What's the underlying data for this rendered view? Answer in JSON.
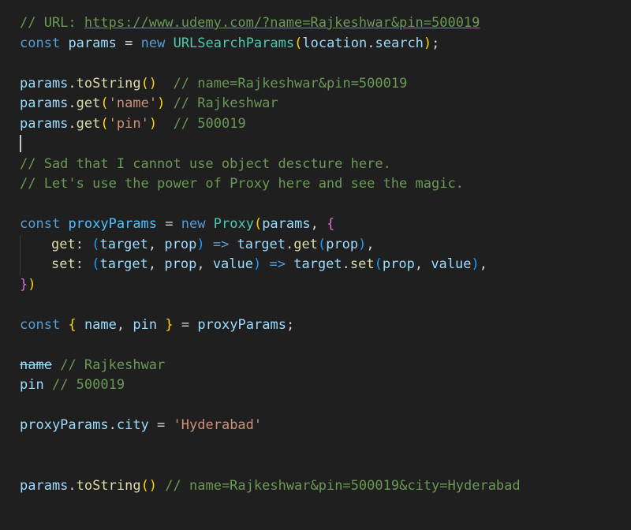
{
  "colors": {
    "background": "#1f1f1f",
    "comment": "#6a9955",
    "keyword": "#569cd6",
    "variable": "#9cdcfe",
    "type": "#4ec9b0",
    "function": "#dcdcaa",
    "string": "#ce9178",
    "bracket_gold": "#ffd700",
    "bracket_violet": "#da70d6",
    "bracket_blue": "#179fff"
  },
  "code": {
    "l1": {
      "comment_prefix": "// URL: ",
      "url": "https://www.udemy.com/?name=Rajkeshwar&pin=500019"
    },
    "l2": {
      "kw_const": "const",
      "var": "params",
      "eq": "=",
      "kw_new": "new",
      "cls": "URLSearchParams",
      "arg_obj": "location",
      "dot": ".",
      "arg_prop": "search",
      "semi": ";"
    },
    "l4": {
      "obj": "params",
      "dot": ".",
      "fn": "toString",
      "comment": "// name=Rajkeshwar&pin=500019"
    },
    "l5": {
      "obj": "params",
      "dot": ".",
      "fn": "get",
      "arg": "'name'",
      "comment": "// Rajkeshwar"
    },
    "l6": {
      "obj": "params",
      "dot": ".",
      "fn": "get",
      "arg": "'pin'",
      "comment": "// 500019"
    },
    "l8": {
      "comment": "// Sad that I cannot use object descture here."
    },
    "l9": {
      "comment": "// Let's use the power of Proxy here and see the magic."
    },
    "l11": {
      "kw_const": "const",
      "var": "proxyParams",
      "eq": "=",
      "kw_new": "new",
      "cls": "Proxy",
      "arg": "params",
      "comma": ","
    },
    "l12": {
      "key": "get",
      "colon": ":",
      "p1": "target",
      "p2": "prop",
      "arrow": "=>",
      "obj": "target",
      "dot": ".",
      "fn": "get",
      "arg": "prop",
      "comma": ","
    },
    "l13": {
      "key": "set",
      "colon": ":",
      "p1": "target",
      "p2": "prop",
      "p3": "value",
      "arrow": "=>",
      "obj": "target",
      "dot": ".",
      "fn": "set",
      "arg1": "prop",
      "arg2": "value",
      "comma": ","
    },
    "l16": {
      "kw_const": "const",
      "v1": "name",
      "v2": "pin",
      "eq": "=",
      "src": "proxyParams",
      "semi": ";"
    },
    "l18": {
      "var": "name",
      "comment": "// Rajkeshwar"
    },
    "l19": {
      "var": "pin",
      "comment": "// 500019"
    },
    "l21": {
      "obj": "proxyParams",
      "dot": ".",
      "prop": "city",
      "eq": "=",
      "str": "'Hyderabad'"
    },
    "l24": {
      "obj": "params",
      "dot": ".",
      "fn": "toString",
      "comment": "// name=Rajkeshwar&pin=500019&city=Hyderabad"
    }
  }
}
